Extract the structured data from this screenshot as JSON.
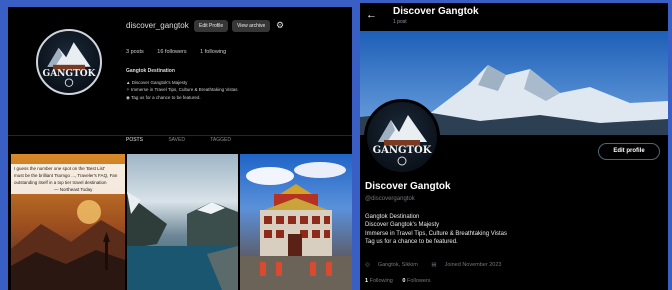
{
  "instagram": {
    "username": "discover_gangtok",
    "edit_profile": "Edit Profile",
    "view_archive": "View archive",
    "settings_icon": "gear-icon",
    "stats": [
      "3 posts",
      "16 followers",
      "1 following"
    ],
    "bio": {
      "name": "Gangtok Destination",
      "line1": "Discover Gangtok's Majesty",
      "line2": "Immerse in Travel Tips, Culture & Breathtaking Vistas",
      "line3": "Tag us for a chance to be featured."
    },
    "tabs": [
      "POSTS",
      "SAVED",
      "TAGGED"
    ],
    "avatar_text": "GANGTOK",
    "tile1_caption": [
      "I guess the number one spot on the 'Best List'",
      "must be the brilliant Tsomgo ..., Traveler's FAQ, Fan",
      "outstanding itself in a top tier travel destination",
      "— Northeast Today"
    ]
  },
  "twitter": {
    "back_icon": "arrow-left-icon",
    "title": "Discover Gangtok",
    "post_count": "1 post",
    "edit_profile": "Edit profile",
    "name": "Discover Gangtok",
    "handle": "@discovergangtok",
    "bio": [
      "Gangtok Destination",
      "Discover Gangtok's Majesty",
      "Immerse in Travel Tips, Culture & Breathtaking Vistas",
      "Tag us for a chance to be featured."
    ],
    "location": "Gangtok, Sikkim",
    "joined": "Joined November 2023",
    "following_count": "1",
    "following_label": "Following",
    "followers_count": "0",
    "followers_label": "Followers",
    "avatar_text": "GANGTOK"
  },
  "colors": {
    "background": "#3a5fc4",
    "panel": "#000000",
    "twitter_muted": "#71767b"
  }
}
